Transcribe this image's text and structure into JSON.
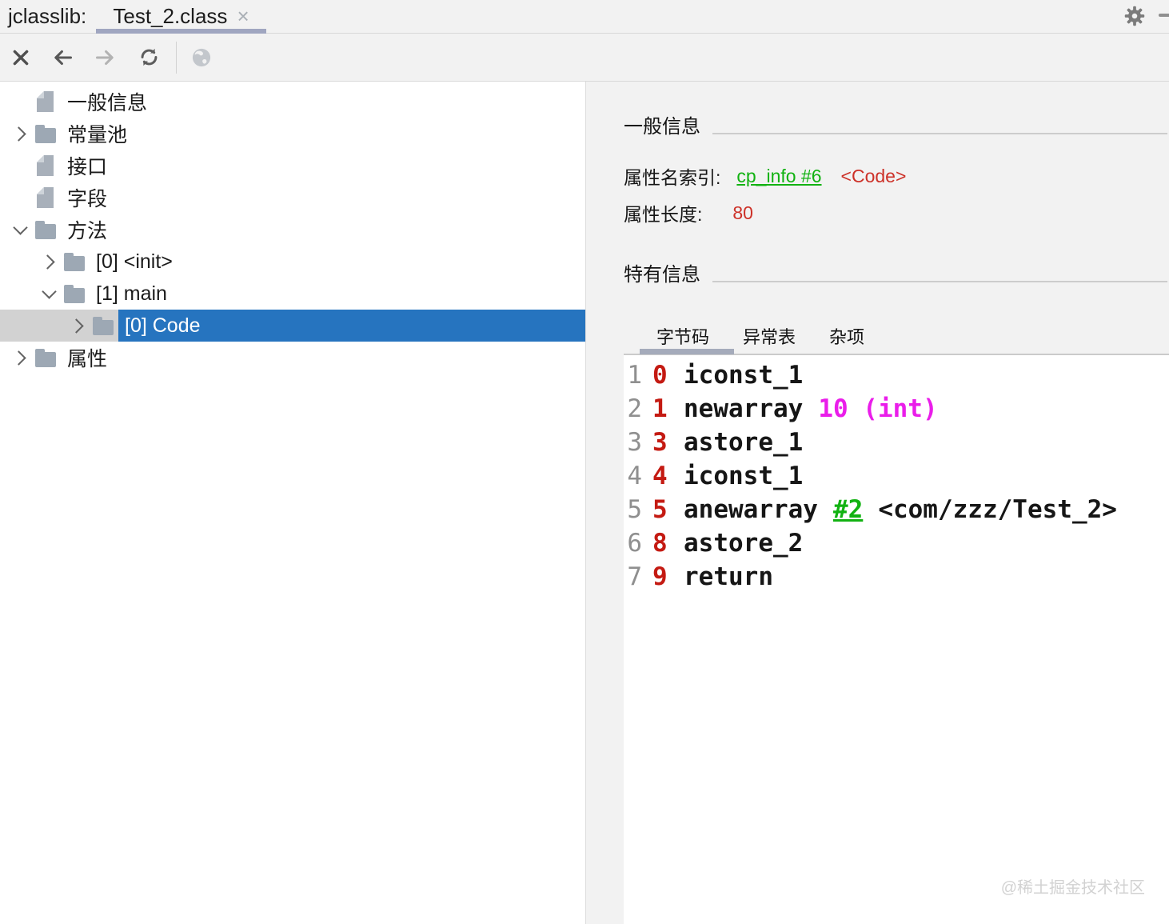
{
  "window": {
    "app_label": "jclasslib:",
    "tab_title": "Test_2.class",
    "tab_close_glyph": "×"
  },
  "toolbar": {
    "icons": [
      {
        "name": "close-icon",
        "enabled": true
      },
      {
        "name": "back-arrow-icon",
        "enabled": true
      },
      {
        "name": "forward-arrow-icon",
        "enabled": false
      },
      {
        "name": "refresh-icon",
        "enabled": true
      },
      {
        "name": "web-globe-icon",
        "enabled": false
      }
    ]
  },
  "tree": {
    "items": [
      {
        "label": "一般信息",
        "icon": "document",
        "indent": 0,
        "expander": null,
        "selected": false
      },
      {
        "label": "常量池",
        "icon": "folder",
        "indent": 0,
        "expander": "collapsed",
        "selected": false
      },
      {
        "label": "接口",
        "icon": "document",
        "indent": 0,
        "expander": null,
        "selected": false
      },
      {
        "label": "字段",
        "icon": "document",
        "indent": 0,
        "expander": null,
        "selected": false
      },
      {
        "label": "方法",
        "icon": "folder",
        "indent": 0,
        "expander": "expanded",
        "selected": false
      },
      {
        "label": "[0] <init>",
        "icon": "folder",
        "indent": 1,
        "expander": "collapsed",
        "selected": false
      },
      {
        "label": "[1] main",
        "icon": "folder",
        "indent": 1,
        "expander": "expanded",
        "selected": false
      },
      {
        "label": "[0] Code",
        "icon": "folder",
        "indent": 2,
        "expander": "collapsed",
        "selected": true
      },
      {
        "label": "属性",
        "icon": "folder",
        "indent": 0,
        "expander": "collapsed",
        "selected": false
      }
    ]
  },
  "detail": {
    "general_section_title": "一般信息",
    "fields": [
      {
        "label": "属性名索引:",
        "link": "cp_info #6",
        "extra": "<Code>"
      },
      {
        "label": "属性长度:",
        "value": "80"
      }
    ],
    "specific_section_title": "特有信息",
    "tabs": [
      {
        "label": "字节码",
        "active": true
      },
      {
        "label": "异常表",
        "active": false
      },
      {
        "label": "杂项",
        "active": false
      }
    ],
    "bytecode": [
      {
        "line": "1",
        "offset": "0",
        "opcode": "iconst_1",
        "operands": []
      },
      {
        "line": "2",
        "offset": "1",
        "opcode": "newarray",
        "operands": [
          {
            "text": "10 (int)",
            "type": "immediate"
          }
        ]
      },
      {
        "line": "3",
        "offset": "3",
        "opcode": "astore_1",
        "operands": []
      },
      {
        "line": "4",
        "offset": "4",
        "opcode": "iconst_1",
        "operands": []
      },
      {
        "line": "5",
        "offset": "5",
        "opcode": "anewarray",
        "operands": [
          {
            "text": "#2",
            "type": "link"
          },
          {
            "text": "<com/zzz/Test_2>",
            "type": "plain"
          }
        ]
      },
      {
        "line": "6",
        "offset": "8",
        "opcode": "astore_2",
        "operands": []
      },
      {
        "line": "7",
        "offset": "9",
        "opcode": "return",
        "operands": []
      }
    ],
    "watermark": "@稀土掘金技术社区"
  },
  "colors": {
    "selection_blue": "#2674bf",
    "tab_indicator": "#a0a6c0",
    "link_green": "#12b212",
    "value_red": "#cd3128",
    "offset_red": "#c41a12",
    "operand_magenta": "#ea1dea"
  }
}
